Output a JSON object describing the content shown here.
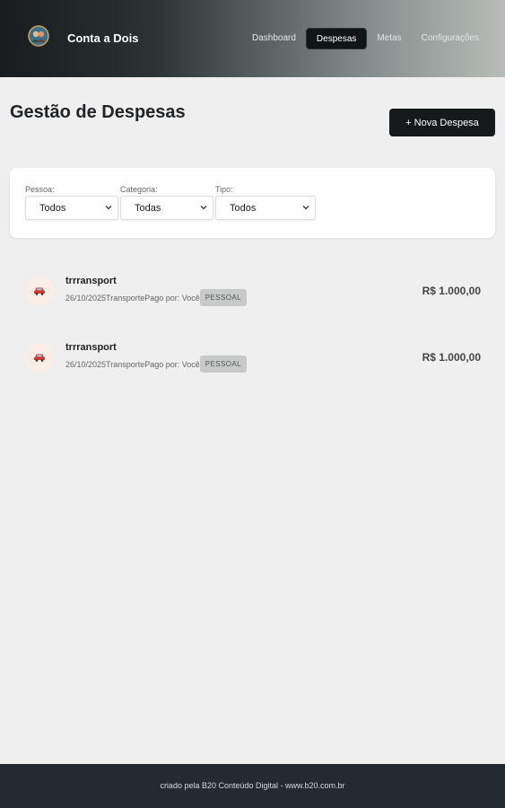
{
  "app": {
    "title": "Conta a Dois",
    "logo_icon": "couple-avatar-icon"
  },
  "nav": {
    "items": [
      {
        "label": "Dashboard",
        "active": false
      },
      {
        "label": "Despesas",
        "active": true
      },
      {
        "label": "Metas",
        "active": false
      },
      {
        "label": "Configurações",
        "active": false
      }
    ]
  },
  "page": {
    "title": "Gestão de Despesas",
    "new_button": "+ Nova Despesa"
  },
  "filters": [
    {
      "label": "Pessoa:",
      "value": "Todos"
    },
    {
      "label": "Categoria:",
      "value": "Todas"
    },
    {
      "label": "Tipo:",
      "value": "Todos"
    }
  ],
  "expenses": [
    {
      "icon": "car-icon",
      "name": "trrransport",
      "date": "26/10/2025",
      "category": "Transporte",
      "paid_by": "Pago por: Você",
      "badge": "PESSOAL",
      "amount": "R$ 1.000,00"
    },
    {
      "icon": "car-icon",
      "name": "trrransport",
      "date": "26/10/2025",
      "category": "Transporte",
      "paid_by": "Pago por: Você",
      "badge": "PESSOAL",
      "amount": "R$ 1.000,00"
    }
  ],
  "footer": {
    "text": "criado pela B20 Conteúdo Digital - www.b20.com.br"
  },
  "colors": {
    "header_dark": "#181c1f",
    "header_light": "#b7bcb8",
    "accent": "#151919",
    "background": "#efefef",
    "footer": "#232a30"
  }
}
